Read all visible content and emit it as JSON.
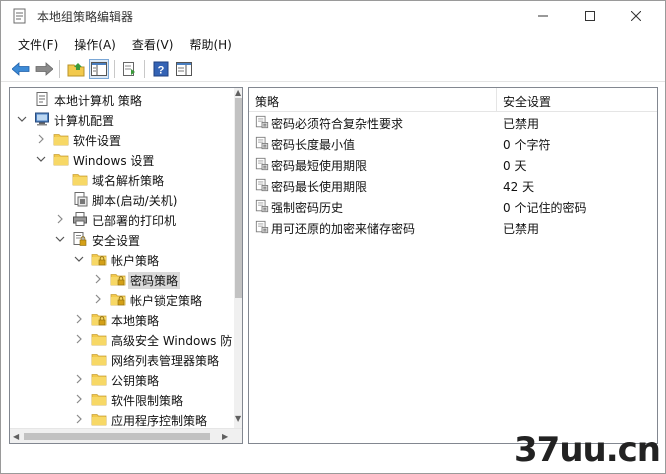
{
  "window": {
    "title": "本地组策略编辑器",
    "controls": {
      "minimize": "—",
      "maximize": "☐",
      "close": "✕"
    }
  },
  "menu": [
    {
      "label": "文件(F)"
    },
    {
      "label": "操作(A)"
    },
    {
      "label": "查看(V)"
    },
    {
      "label": "帮助(H)"
    }
  ],
  "toolbar": {
    "buttons": [
      "back-arrow-icon",
      "forward-arrow-icon",
      "folder-up-icon",
      "show-hide-tree-icon",
      "export-list-icon",
      "help-icon",
      "properties-pane-icon"
    ]
  },
  "tree": {
    "items": [
      {
        "label": "本地计算机 策略",
        "depth": 0,
        "expander": "none",
        "icon": "policy-doc-icon"
      },
      {
        "label": "计算机配置",
        "depth": 0,
        "expander": "expanded",
        "icon": "computer-icon"
      },
      {
        "label": "软件设置",
        "depth": 1,
        "expander": "collapsed",
        "icon": "folder-icon"
      },
      {
        "label": "Windows 设置",
        "depth": 1,
        "expander": "expanded",
        "icon": "folder-icon"
      },
      {
        "label": "域名解析策略",
        "depth": 2,
        "expander": "none",
        "icon": "folder-icon"
      },
      {
        "label": "脚本(启动/关机)",
        "depth": 2,
        "expander": "none",
        "icon": "script-icon"
      },
      {
        "label": "已部署的打印机",
        "depth": 2,
        "expander": "collapsed",
        "icon": "printer-icon"
      },
      {
        "label": "安全设置",
        "depth": 2,
        "expander": "expanded",
        "icon": "security-settings-icon"
      },
      {
        "label": "帐户策略",
        "depth": 3,
        "expander": "expanded",
        "icon": "locked-folder-icon"
      },
      {
        "label": "密码策略",
        "depth": 4,
        "expander": "collapsed",
        "icon": "locked-folder-icon",
        "selected": true
      },
      {
        "label": "帐户锁定策略",
        "depth": 4,
        "expander": "collapsed",
        "icon": "locked-folder-icon"
      },
      {
        "label": "本地策略",
        "depth": 3,
        "expander": "collapsed",
        "icon": "locked-folder-icon"
      },
      {
        "label": "高级安全 Windows 防",
        "depth": 3,
        "expander": "collapsed",
        "icon": "folder-icon"
      },
      {
        "label": "网络列表管理器策略",
        "depth": 3,
        "expander": "none",
        "icon": "folder-icon"
      },
      {
        "label": "公钥策略",
        "depth": 3,
        "expander": "collapsed",
        "icon": "folder-icon"
      },
      {
        "label": "软件限制策略",
        "depth": 3,
        "expander": "collapsed",
        "icon": "folder-icon"
      },
      {
        "label": "应用程序控制策略",
        "depth": 3,
        "expander": "collapsed",
        "icon": "folder-icon"
      }
    ]
  },
  "list": {
    "columns": [
      "策略",
      "安全设置"
    ],
    "sort_indicator": "^",
    "rows": [
      {
        "policy": "密码必须符合复杂性要求",
        "setting": "已禁用"
      },
      {
        "policy": "密码长度最小值",
        "setting": "0 个字符"
      },
      {
        "policy": "密码最短使用期限",
        "setting": "0 天"
      },
      {
        "policy": "密码最长使用期限",
        "setting": "42 天"
      },
      {
        "policy": "强制密码历史",
        "setting": "0 个记住的密码"
      },
      {
        "policy": "用可还原的加密来储存密码",
        "setting": "已禁用"
      }
    ]
  },
  "watermark": {
    "text": "37uu.cn"
  },
  "colors": {
    "selection": "#d9d9d9",
    "border": "#828790",
    "folder": "#f2c94c",
    "lock": "#d4a017"
  }
}
